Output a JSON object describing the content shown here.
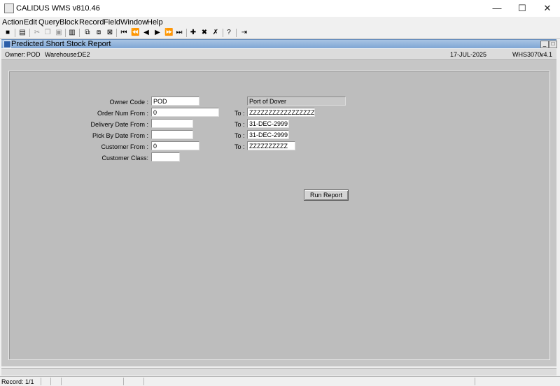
{
  "window": {
    "title": "CALIDUS WMS v810.46",
    "minimize": "—",
    "maximize": "☐",
    "close": "✕"
  },
  "menu": [
    "Action",
    "Edit",
    "Query",
    "Block",
    "Record",
    "Field",
    "Window",
    "Help"
  ],
  "toolbar_icons": [
    "save-icon",
    "print-icon",
    "cut-icon",
    "copy-icon",
    "paste-icon",
    "clear-icon",
    "insert-icon",
    "duplicate-icon",
    "query-icon",
    "first-record-icon",
    "previous-set-icon",
    "previous-record-icon",
    "next-record-icon",
    "next-set-icon",
    "last-record-icon",
    "add-record-icon",
    "delete-record-icon",
    "clear-record-icon",
    "help-icon",
    "exit-icon"
  ],
  "form": {
    "title": "Predicted Short Stock Report"
  },
  "info": {
    "owner_label": "Owner:",
    "owner": "POD",
    "warehouse_label": "Warehouse:",
    "warehouse": "DE2",
    "date": "17-JUL-2025",
    "module": "WHS3070",
    "version": "v4.1"
  },
  "fields": {
    "owner_code_label": "Owner Code :",
    "owner_code": "POD",
    "owner_name": "Port of Dover",
    "order_from_label": "Order Num From :",
    "order_from": "0",
    "order_to": "ZZZZZZZZZZZZZZZZZZZZ",
    "delivery_from_label": "Delivery Date From :",
    "delivery_from": "",
    "delivery_to": "31-DEC-2999",
    "pickby_from_label": "Pick By Date From :",
    "pickby_from": "",
    "pickby_to": "31-DEC-2999",
    "customer_from_label": "Customer From :",
    "customer_from": "0",
    "customer_to": "ZZZZZZZZZZ",
    "customer_class_label": "Customer Class:",
    "customer_class": "",
    "to_label": "To :"
  },
  "run_report_label": "Run Report",
  "status": {
    "record": "Record: 1/1"
  }
}
